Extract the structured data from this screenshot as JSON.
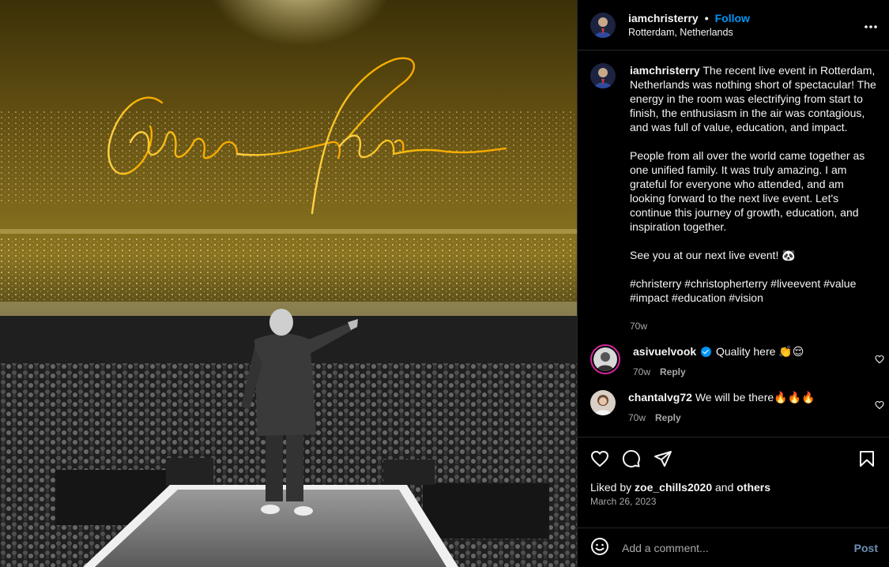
{
  "header": {
    "username": "iamchristerry",
    "separator": "•",
    "follow_label": "Follow",
    "location": "Rotterdam, Netherlands",
    "more_icon": "more-horizontal-icon"
  },
  "caption": {
    "username": "iamchristerry",
    "paragraph1": "The recent live event in Rotterdam, Netherlands was nothing short of spectacular! The energy in the room was electrifying from start to finish, the enthusiasm in the air was contagious, and was full of value, education, and impact.",
    "paragraph2": "People from all over the world came together as one unified family. It was truly amazing. I am grateful for everyone who attended, and am looking forward to the next live event. Let's continue this journey of growth, education, and inspiration together.",
    "paragraph3": "See you at our next live event! 🐼",
    "hashtags": "#christerry #christopherterry #liveevent #value #impact #education #vision",
    "time": "70w"
  },
  "comments": [
    {
      "username": "asivuelvook",
      "verified": true,
      "text": "Quality here 👏😌",
      "time": "70w",
      "reply_label": "Reply"
    },
    {
      "username": "chantalvg72",
      "verified": false,
      "text": "We will be there🔥🔥🔥",
      "time": "70w",
      "reply_label": "Reply"
    }
  ],
  "likes": {
    "prefix": "Liked by",
    "user": "zoe_chills2020",
    "conjunction": "and",
    "others": "others"
  },
  "date": "March 26, 2023",
  "add_comment": {
    "placeholder": "Add a comment...",
    "post_label": "Post"
  },
  "colors": {
    "accent": "#0095f6",
    "gold": "#f5b400",
    "background": "#000000"
  }
}
